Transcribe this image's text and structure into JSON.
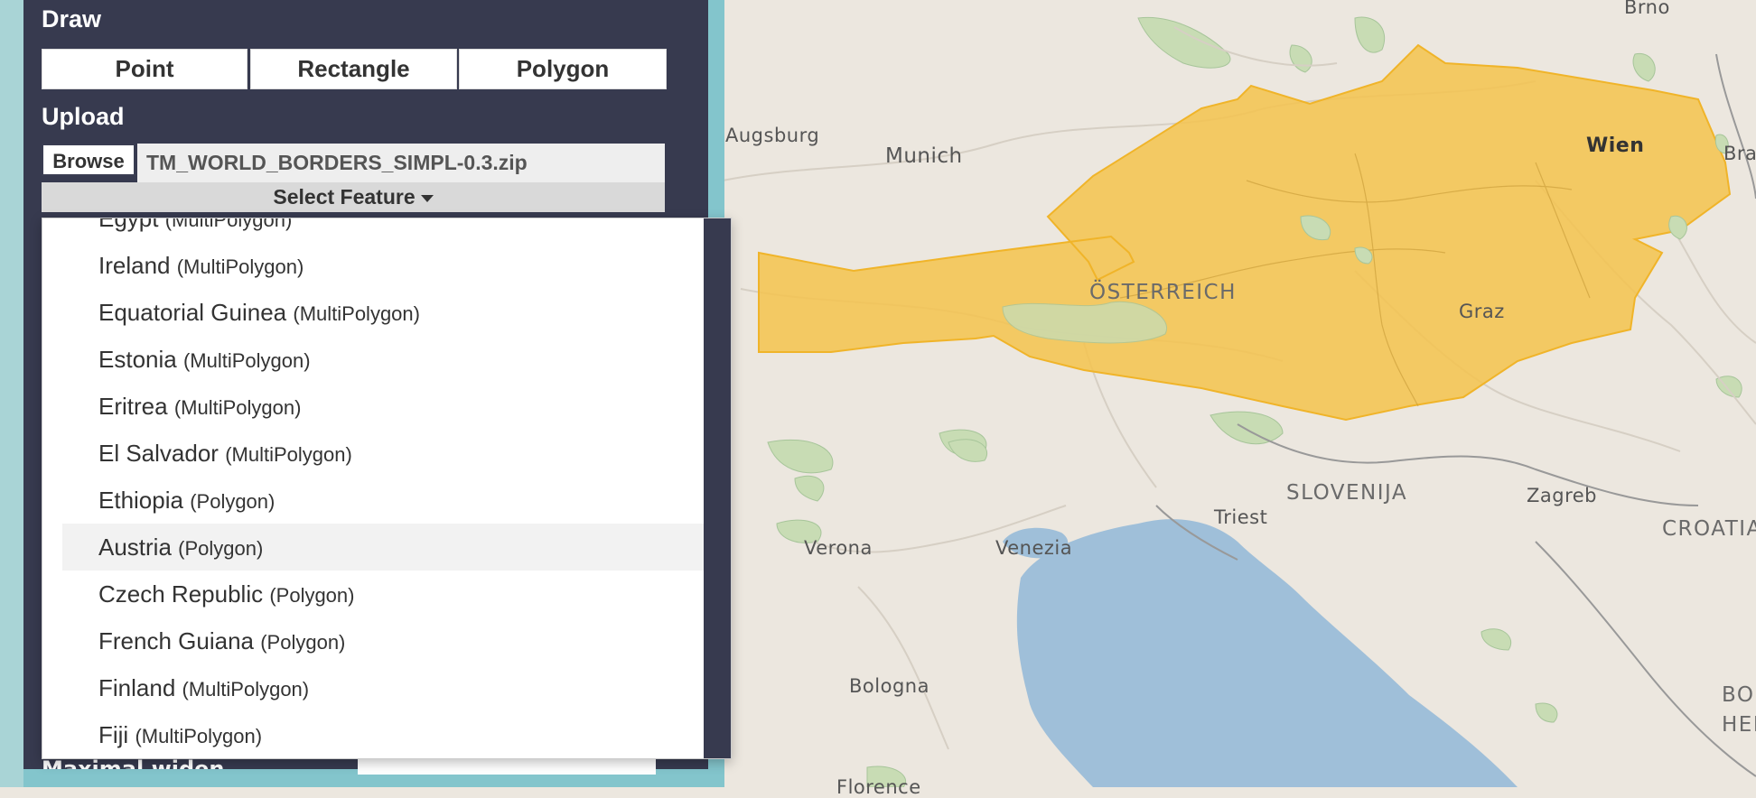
{
  "map": {
    "labels": {
      "brno": "Brno",
      "augsburg": "Augsburg",
      "munich": "Munich",
      "wien": "Wien",
      "brat": "Brat",
      "osterreich": "ÖSTERREICH",
      "graz": "Graz",
      "slovenija": "SLOVENIJA",
      "triest": "Triest",
      "zagreb": "Zagreb",
      "croatia": "CROATIA",
      "verona": "Verona",
      "venezia": "Venezia",
      "bologna": "Bologna",
      "bo": "BO",
      "her": "HER",
      "florence": "Florence"
    },
    "colors": {
      "land": "#ece7df",
      "sea": "#9fbfd9",
      "selection_fill": "#f4c34d",
      "selection_stroke": "#f0b429",
      "forest": "#c8dcb4"
    }
  },
  "panel": {
    "draw_title": "Draw",
    "draw_buttons": [
      "Point",
      "Rectangle",
      "Polygon"
    ],
    "upload_title": "Upload",
    "browse_label": "Browse",
    "file_name": "TM_WORLD_BORDERS_SIMPL-0.3.zip",
    "select_feature_label": "Select Feature",
    "dropdown_items": [
      {
        "name": "Egypt",
        "kind": "(MultiPolygon)"
      },
      {
        "name": "Ireland",
        "kind": "(MultiPolygon)"
      },
      {
        "name": "Equatorial Guinea",
        "kind": "(MultiPolygon)"
      },
      {
        "name": "Estonia",
        "kind": "(MultiPolygon)"
      },
      {
        "name": "Eritrea",
        "kind": "(MultiPolygon)"
      },
      {
        "name": "El Salvador",
        "kind": "(MultiPolygon)"
      },
      {
        "name": "Ethiopia",
        "kind": "(Polygon)"
      },
      {
        "name": "Austria",
        "kind": "(Polygon)",
        "selected": true
      },
      {
        "name": "Czech Republic",
        "kind": "(Polygon)"
      },
      {
        "name": "French Guiana",
        "kind": "(Polygon)"
      },
      {
        "name": "Finland",
        "kind": "(MultiPolygon)"
      },
      {
        "name": "Fiji",
        "kind": "(MultiPolygon)"
      }
    ],
    "bottom_partial_text": "Maximal widen"
  }
}
